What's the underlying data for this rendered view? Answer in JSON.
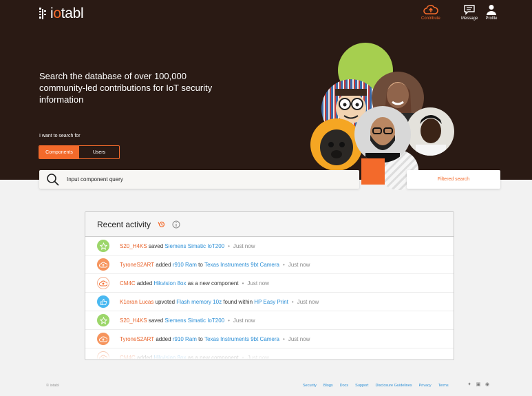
{
  "brand": {
    "logo_text_1": "i",
    "logo_text_o": "o",
    "logo_text_2": "tabl"
  },
  "nav": {
    "contribute": "Contribute",
    "message": "Message",
    "profile": "Profile"
  },
  "hero": {
    "headline": "Search the database of over 100,000 community-led contributions for IoT security information",
    "want_label": "I want to search for",
    "toggle": {
      "components": "Components",
      "users": "Users",
      "selected": "Components"
    }
  },
  "search": {
    "placeholder": "Input component query",
    "filtered_label": "Filtered search"
  },
  "activity": {
    "title": "Recent activity",
    "rows": [
      {
        "icon": "star-icon",
        "user": "S20_H4KS",
        "t1": " saved ",
        "a": "Siemens Simatic IoT200",
        "t2": "",
        "b": "",
        "t3": "",
        "time": "Just now"
      },
      {
        "icon": "upload-cloud-icon",
        "user": "TyroneS2ART",
        "t1": " added ",
        "a": "r910 Ram",
        "t2": " to ",
        "b": "Texas Instruments 9bt Camera",
        "t3": "",
        "time": "Just now"
      },
      {
        "icon": "upload-cloud-outline-icon",
        "user": "CM4C",
        "t1": " added ",
        "a": "Hikvision 8ox",
        "t2": " as a new component",
        "b": "",
        "t3": "",
        "time": "Just now"
      },
      {
        "icon": "thumbs-up-icon",
        "user": "K1eran Lucas",
        "t1": " upvoted ",
        "a": "Flash memory 10z",
        "t2": " found within ",
        "b": "HP Easy Print",
        "t3": "",
        "time": "Just now"
      },
      {
        "icon": "star-icon",
        "user": "S20_H4KS",
        "t1": " saved ",
        "a": "Siemens Simatic IoT200",
        "t2": "",
        "b": "",
        "t3": "",
        "time": "Just now"
      },
      {
        "icon": "upload-cloud-icon",
        "user": "TyroneS2ART",
        "t1": " added ",
        "a": "r910 Ram",
        "t2": " to ",
        "b": "Texas Instruments 9bt Camera",
        "t3": "",
        "time": "Just now"
      },
      {
        "icon": "upload-cloud-outline-icon",
        "user": "CM4C",
        "t1": " added ",
        "a": "Hikvision 8ox",
        "t2": " as a new component",
        "b": "",
        "t3": "",
        "time": "Just now"
      }
    ]
  },
  "footer": {
    "copyright": "© iotabl",
    "links": [
      "Security",
      "Blogs",
      "Docs",
      "Support",
      "Disclosure Guidelines",
      "Privacy",
      "Terms"
    ],
    "social": [
      "twitter-icon",
      "linkedin-icon",
      "discord-icon"
    ]
  },
  "colors": {
    "accent": "#f36a2b",
    "hero_bg": "#2a1a14",
    "link": "#2c8fd6"
  }
}
